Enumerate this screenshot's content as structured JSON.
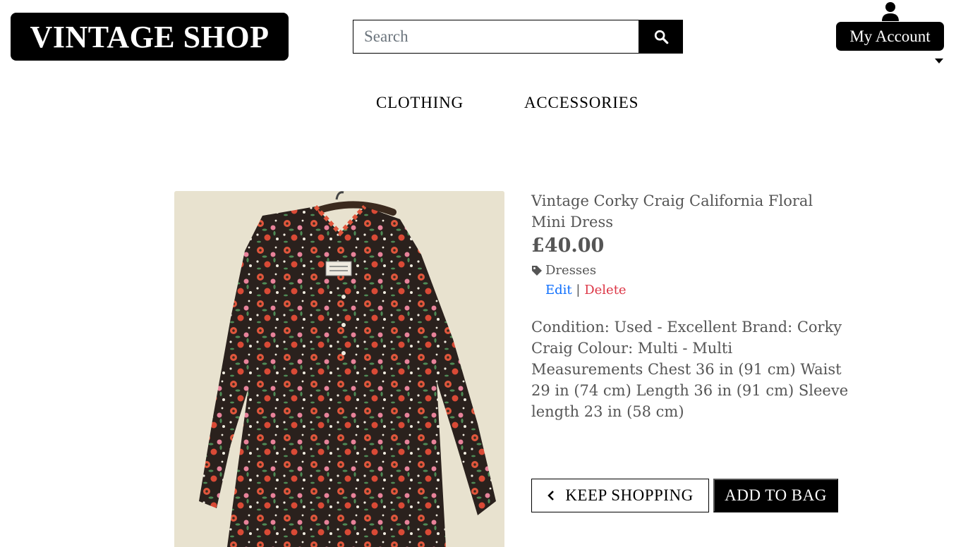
{
  "header": {
    "logo_text": "VINTAGE SHOP",
    "search_placeholder": "Search",
    "search_icon": "search-icon",
    "account_label": "My Account",
    "account_icon": "user-icon"
  },
  "nav": {
    "items": [
      {
        "label": "CLOTHING"
      },
      {
        "label": "ACCESSORIES"
      }
    ]
  },
  "product": {
    "title": "Vintage Corky Craig California Floral Mini Dress",
    "price": "£40.00",
    "category": "Dresses",
    "category_icon": "tag-icon",
    "edit_label": "Edit",
    "separator": "|",
    "delete_label": "Delete",
    "description": "Condition: Used - Excellent Brand: Corky Craig Colour: Multi - Multi Measurements Chest 36 in (91 cm) Waist 29 in (74 cm) Length 36 in (91 cm) Sleeve length 23 in (58 cm)"
  },
  "actions": {
    "keep_shopping_label": "KEEP SHOPPING",
    "add_to_bag_label": "ADD TO BAG"
  },
  "colors": {
    "primary": "#000000",
    "edit": "#0d6efd",
    "delete": "#dc3545",
    "text_muted": "#555555"
  }
}
